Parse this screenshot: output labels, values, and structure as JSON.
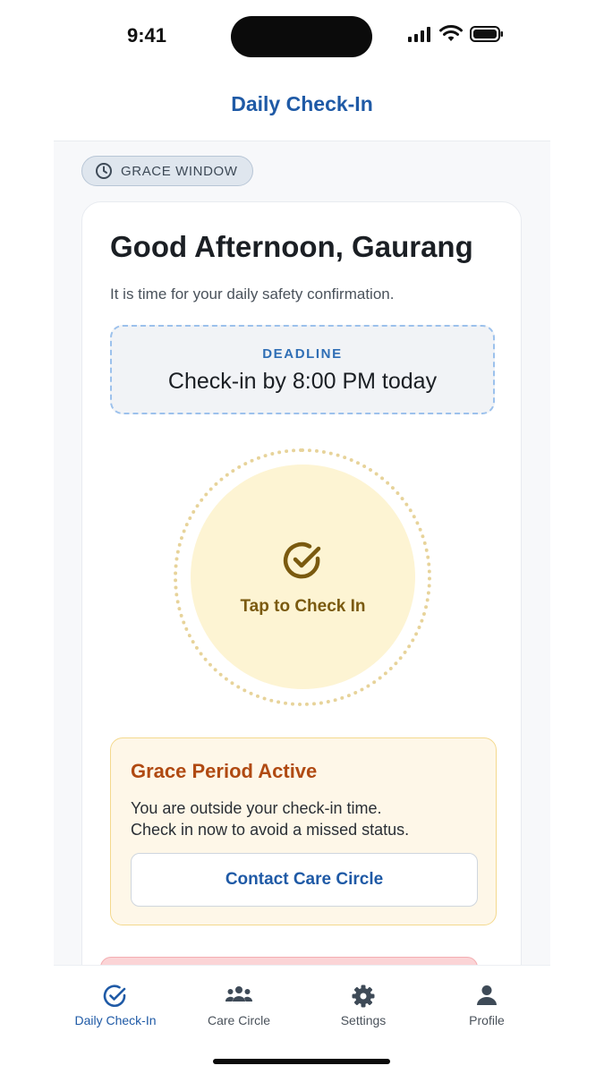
{
  "status_bar": {
    "time": "9:41"
  },
  "header": {
    "title": "Daily Check-In"
  },
  "badge": {
    "label": "GRACE WINDOW",
    "icon": "clock-icon"
  },
  "card": {
    "greeting": "Good Afternoon, Gaurang",
    "subtitle": "It is time for your daily safety confirmation.",
    "deadline": {
      "label": "DEADLINE",
      "text": "Check-in by 8:00 PM today"
    },
    "check_in": {
      "label": "Tap to Check In",
      "icon": "check-circle-icon"
    },
    "grace": {
      "title": "Grace Period Active",
      "body_line1": "You are outside your check-in time.",
      "body_line2": "Check in now to avoid a missed status.",
      "button_label": "Contact Care Circle"
    }
  },
  "tabs": [
    {
      "label": "Daily Check-In",
      "icon": "check-circle-icon",
      "active": true
    },
    {
      "label": "Care Circle",
      "icon": "group-icon",
      "active": false
    },
    {
      "label": "Settings",
      "icon": "gear-icon",
      "active": false
    },
    {
      "label": "Profile",
      "icon": "person-icon",
      "active": false
    }
  ],
  "colors": {
    "primary": "#1f5aa6",
    "grace_title": "#b04a12",
    "check_bg": "#fdf4d3",
    "check_text": "#7a5a0f"
  }
}
